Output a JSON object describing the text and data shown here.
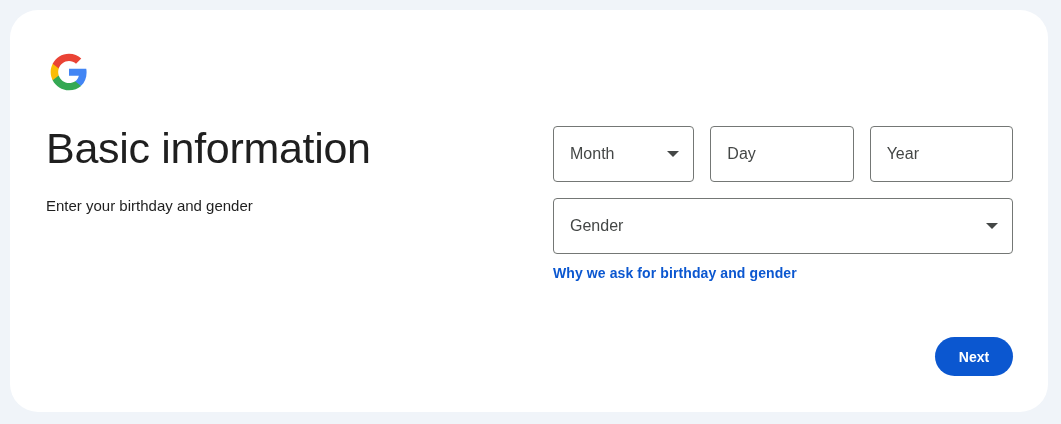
{
  "heading": "Basic information",
  "subtitle": "Enter your birthday and gender",
  "birthday_fields": [
    {
      "kind": "select",
      "label": "Month"
    },
    {
      "kind": "text",
      "placeholder": "Day"
    },
    {
      "kind": "text",
      "placeholder": "Year"
    }
  ],
  "gender_field": {
    "kind": "select",
    "label": "Gender"
  },
  "help_link": "Why we ask for birthday and gender",
  "next_button": "Next"
}
